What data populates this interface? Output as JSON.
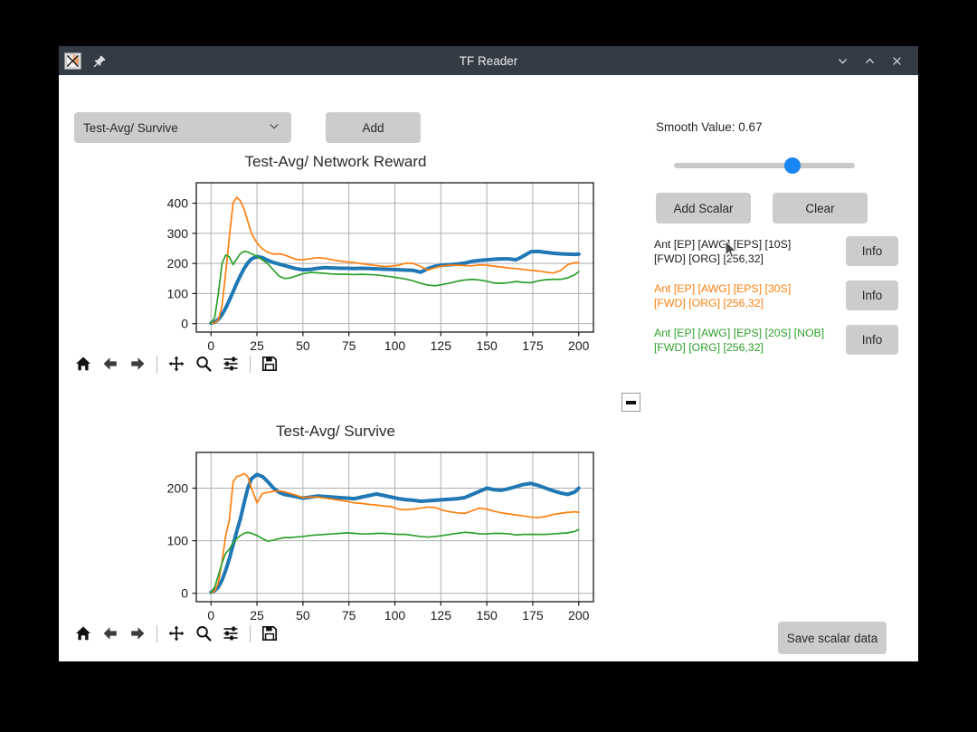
{
  "window": {
    "title": "TF Reader",
    "app_icon": "matplotlib-app-icon",
    "pin_icon": "pin-icon",
    "controls": [
      {
        "name": "minimize-button",
        "icon": "chevron-down-icon"
      },
      {
        "name": "maximize-button",
        "icon": "chevron-up-icon"
      },
      {
        "name": "close-button",
        "icon": "close-icon"
      }
    ]
  },
  "toolbar": {
    "scalar_select_value": "Test-Avg/ Survive",
    "scalar_select_options": [
      "Test-Avg/ Survive",
      "Test-Avg/ Network Reward"
    ],
    "dropdown_icon": "chevron-down-icon",
    "add_label": "Add"
  },
  "controls": {
    "smooth_label": "Smooth Value: 0.67",
    "smooth_value": 0.67,
    "smooth_min": 0,
    "smooth_max": 1,
    "add_scalar_label": "Add Scalar",
    "clear_label": "Clear",
    "save_scalar_label": "Save scalar data"
  },
  "runs": [
    {
      "label": "Ant [EP] [AWG] [EPS] [10S]\n [FWD] [ORG] [256,32]",
      "color": "#1f77b4",
      "text_color": "#1a1a1a",
      "info_label": "Info"
    },
    {
      "label": "Ant [EP] [AWG] [EPS] [30S]\n [FWD] [ORG] [256,32]",
      "color": "#ff7f0e",
      "text_color": "#ff7f0e",
      "info_label": "Info"
    },
    {
      "label": "Ant [EP] [AWG] [EPS] [20S] [NOB]\n [FWD] [ORG] [256,32]",
      "color": "#2ca02c",
      "text_color": "#2ca02c",
      "info_label": "Info"
    }
  ],
  "mpl_toolbar_icons": [
    "home-icon",
    "back-arrow-icon",
    "forward-arrow-icon",
    "pan-move-icon",
    "zoom-magnifier-icon",
    "configure-subplots-icon",
    "save-floppy-icon"
  ],
  "remove_button_icon": "minus-icon",
  "chart_data": [
    {
      "type": "line",
      "title": "Test-Avg/ Network Reward",
      "xlabel": "",
      "ylabel": "",
      "xlim": [
        -8,
        208
      ],
      "ylim": [
        -28,
        468
      ],
      "xticks": [
        0,
        25,
        50,
        75,
        100,
        125,
        150,
        175,
        200
      ],
      "yticks": [
        0,
        100,
        200,
        300,
        400
      ],
      "grid": true,
      "legend": "none",
      "x": [
        0,
        2,
        4,
        6,
        8,
        10,
        12,
        14,
        16,
        18,
        20,
        22,
        25,
        28,
        31,
        34,
        37,
        40,
        43,
        46,
        50,
        54,
        58,
        62,
        66,
        70,
        74,
        78,
        82,
        86,
        90,
        94,
        98,
        102,
        106,
        110,
        114,
        118,
        122,
        126,
        130,
        134,
        138,
        142,
        146,
        150,
        154,
        158,
        162,
        166,
        170,
        174,
        178,
        182,
        186,
        190,
        194,
        198,
        200
      ],
      "series": [
        {
          "name": "Ant [EP] [AWG] [EPS] [10S] [FWD] [ORG] [256,32]",
          "color": "#1f77b4",
          "linewidth": 4,
          "values": [
            2,
            5,
            14,
            30,
            52,
            78,
            106,
            134,
            160,
            183,
            202,
            215,
            223,
            219,
            210,
            203,
            198,
            193,
            188,
            183,
            179,
            180,
            184,
            186,
            185,
            184,
            184,
            183,
            184,
            183,
            182,
            181,
            180,
            179,
            178,
            177,
            171,
            183,
            191,
            194,
            196,
            198,
            201,
            207,
            210,
            212,
            214,
            215,
            215,
            212,
            225,
            239,
            240,
            237,
            234,
            232,
            231,
            230,
            231
          ]
        },
        {
          "name": "Ant [EP] [AWG] [EPS] [30S] [FWD] [ORG] [256,32]",
          "color": "#ff7f0e",
          "linewidth": 1.7,
          "values": [
            1,
            3,
            12,
            60,
            170,
            290,
            400,
            420,
            408,
            380,
            340,
            300,
            268,
            248,
            237,
            231,
            232,
            228,
            221,
            214,
            212,
            216,
            219,
            217,
            212,
            208,
            205,
            203,
            199,
            196,
            193,
            190,
            191,
            194,
            201,
            200,
            190,
            178,
            186,
            192,
            194,
            194,
            193,
            192,
            195,
            194,
            191,
            188,
            185,
            183,
            180,
            177,
            175,
            171,
            168,
            176,
            196,
            203,
            202
          ]
        },
        {
          "name": "Ant [EP] [AWG] [EPS] [20S] [NOB] [FWD] [ORG] [256,32]",
          "color": "#2ca02c",
          "linewidth": 1.7,
          "values": [
            2,
            20,
            100,
            200,
            228,
            222,
            196,
            215,
            233,
            240,
            238,
            232,
            224,
            212,
            198,
            178,
            158,
            150,
            152,
            158,
            166,
            170,
            169,
            167,
            165,
            164,
            164,
            163,
            164,
            163,
            162,
            159,
            156,
            152,
            148,
            142,
            134,
            128,
            126,
            130,
            135,
            141,
            145,
            147,
            145,
            141,
            135,
            134,
            136,
            140,
            137,
            136,
            142,
            146,
            147,
            147,
            152,
            163,
            173
          ]
        }
      ]
    },
    {
      "type": "line",
      "title": "Test-Avg/ Survive",
      "xlabel": "",
      "ylabel": "",
      "xlim": [
        -8,
        208
      ],
      "ylim": [
        -16,
        268
      ],
      "xticks": [
        0,
        25,
        50,
        75,
        100,
        125,
        150,
        175,
        200
      ],
      "yticks": [
        0,
        100,
        200
      ],
      "grid": true,
      "legend": "none",
      "x": [
        0,
        2,
        4,
        6,
        8,
        10,
        12,
        14,
        16,
        18,
        20,
        22,
        25,
        28,
        31,
        34,
        37,
        40,
        43,
        46,
        50,
        54,
        58,
        62,
        66,
        70,
        74,
        78,
        82,
        86,
        90,
        94,
        98,
        102,
        106,
        110,
        114,
        118,
        122,
        126,
        130,
        134,
        138,
        142,
        146,
        150,
        154,
        158,
        162,
        166,
        170,
        174,
        178,
        182,
        186,
        190,
        194,
        198,
        200
      ],
      "series": [
        {
          "name": "Ant [EP] [AWG] [EPS] [10S] [FWD] [ORG] [256,32]",
          "color": "#1f77b4",
          "linewidth": 4,
          "values": [
            2,
            5,
            12,
            25,
            44,
            66,
            92,
            118,
            142,
            172,
            200,
            218,
            226,
            222,
            212,
            200,
            192,
            188,
            186,
            184,
            181,
            183,
            185,
            184,
            183,
            182,
            181,
            180,
            183,
            186,
            189,
            186,
            183,
            180,
            178,
            177,
            175,
            176,
            177,
            178,
            179,
            180,
            182,
            188,
            194,
            200,
            197,
            196,
            199,
            203,
            207,
            209,
            205,
            200,
            195,
            191,
            188,
            193,
            200
          ]
        },
        {
          "name": "Ant [EP] [AWG] [EPS] [30S] [FWD] [ORG] [256,32]",
          "color": "#ff7f0e",
          "linewidth": 1.7,
          "values": [
            1,
            4,
            20,
            60,
            110,
            140,
            212,
            222,
            224,
            228,
            222,
            200,
            172,
            190,
            192,
            194,
            195,
            193,
            190,
            187,
            182,
            183,
            183,
            181,
            179,
            177,
            175,
            172,
            171,
            169,
            168,
            166,
            165,
            160,
            159,
            160,
            162,
            164,
            163,
            158,
            155,
            153,
            152,
            157,
            162,
            160,
            156,
            153,
            151,
            149,
            147,
            145,
            144,
            146,
            150,
            152,
            154,
            155,
            154
          ]
        },
        {
          "name": "Ant [EP] [AWG] [EPS] [20S] [NOB] [FWD] [ORG] [256,32]",
          "color": "#2ca02c",
          "linewidth": 1.7,
          "values": [
            2,
            12,
            34,
            58,
            76,
            84,
            96,
            104,
            110,
            114,
            116,
            114,
            110,
            104,
            99,
            101,
            104,
            106,
            106,
            107,
            108,
            110,
            111,
            112,
            113,
            114,
            115,
            114,
            113,
            113,
            114,
            114,
            113,
            112,
            112,
            110,
            108,
            107,
            108,
            110,
            112,
            114,
            116,
            115,
            113,
            113,
            114,
            114,
            113,
            111,
            112,
            112,
            112,
            112,
            113,
            114,
            115,
            118,
            121
          ]
        }
      ]
    }
  ]
}
